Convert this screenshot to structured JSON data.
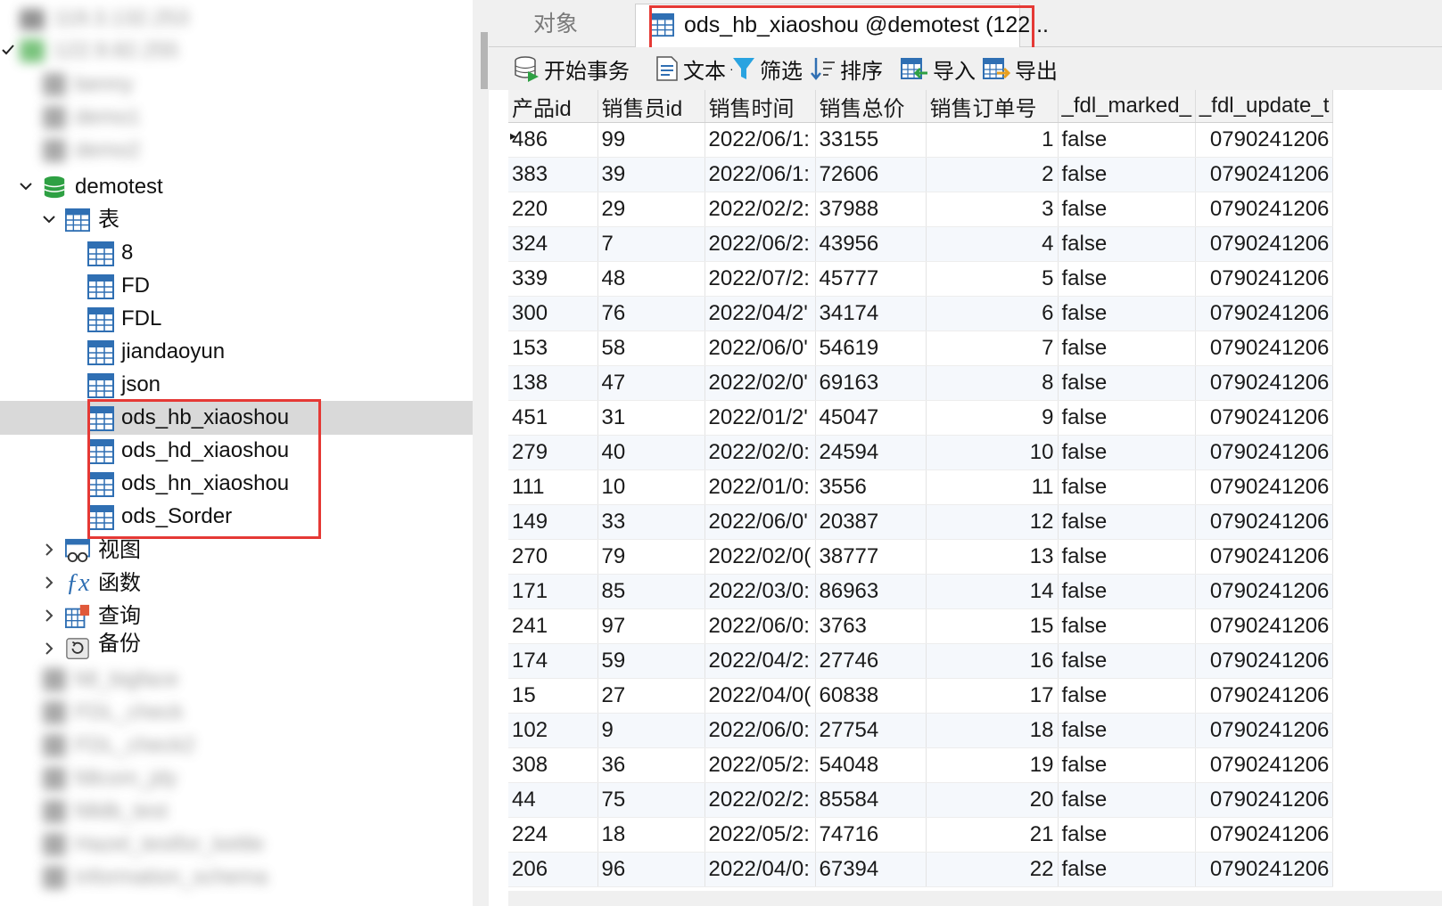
{
  "nav": {
    "connections": [
      "119.3.132.253",
      "122.9.82.255"
    ],
    "dbs_before": [
      "benny",
      "demo1",
      "demo2"
    ],
    "database": "demotest",
    "tables_group": "表",
    "tables": [
      "8",
      "FD",
      "FDL",
      "jiandaoyun",
      "json",
      "ods_hb_xiaoshou",
      "ods_hd_xiaoshou",
      "ods_hn_xiaoshou",
      "ods_Sorder"
    ],
    "selected_table": "ods_hb_xiaoshou",
    "groups": [
      "视图",
      "函数",
      "查询",
      "备份"
    ],
    "dbs_after": [
      "fdl_bigface",
      "FDL_check",
      "FDL_check2",
      "fdlcom_jdy",
      "fdldb_test",
      "Hazel_testfor_kettle",
      "information_schema"
    ]
  },
  "tabs": {
    "objects": "对象",
    "active": "ods_hb_xiaoshou @demotest (122..."
  },
  "toolbar": {
    "begin_tx": "开始事务",
    "text": "文本",
    "filter": "筛选",
    "sort": "排序",
    "import": "导入",
    "export": "导出"
  },
  "grid": {
    "columns": [
      "产品id",
      "销售员id",
      "销售时间",
      "销售总价",
      "销售订单号",
      "_fdl_marked_",
      "_fdl_update_t"
    ],
    "rows": [
      [
        "486",
        "99",
        "2022/06/1:",
        "33155",
        "1",
        "false",
        "0790241206"
      ],
      [
        "383",
        "39",
        "2022/06/1:",
        "72606",
        "2",
        "false",
        "0790241206"
      ],
      [
        "220",
        "29",
        "2022/02/2:",
        "37988",
        "3",
        "false",
        "0790241206"
      ],
      [
        "324",
        "7",
        "2022/06/2:",
        "43956",
        "4",
        "false",
        "0790241206"
      ],
      [
        "339",
        "48",
        "2022/07/2:",
        "45777",
        "5",
        "false",
        "0790241206"
      ],
      [
        "300",
        "76",
        "2022/04/2'",
        "34174",
        "6",
        "false",
        "0790241206"
      ],
      [
        "153",
        "58",
        "2022/06/0'",
        "54619",
        "7",
        "false",
        "0790241206"
      ],
      [
        "138",
        "47",
        "2022/02/0'",
        "69163",
        "8",
        "false",
        "0790241206"
      ],
      [
        "451",
        "31",
        "2022/01/2'",
        "45047",
        "9",
        "false",
        "0790241206"
      ],
      [
        "279",
        "40",
        "2022/02/0:",
        "24594",
        "10",
        "false",
        "0790241206"
      ],
      [
        "111",
        "10",
        "2022/01/0:",
        "3556",
        "11",
        "false",
        "0790241206"
      ],
      [
        "149",
        "33",
        "2022/06/0'",
        "20387",
        "12",
        "false",
        "0790241206"
      ],
      [
        "270",
        "79",
        "2022/02/0(",
        "38777",
        "13",
        "false",
        "0790241206"
      ],
      [
        "171",
        "85",
        "2022/03/0:",
        "86963",
        "14",
        "false",
        "0790241206"
      ],
      [
        "241",
        "97",
        "2022/06/0:",
        "3763",
        "15",
        "false",
        "0790241206"
      ],
      [
        "174",
        "59",
        "2022/04/2:",
        "27746",
        "16",
        "false",
        "0790241206"
      ],
      [
        "15",
        "27",
        "2022/04/0(",
        "60838",
        "17",
        "false",
        "0790241206"
      ],
      [
        "102",
        "9",
        "2022/06/0:",
        "27754",
        "18",
        "false",
        "0790241206"
      ],
      [
        "308",
        "36",
        "2022/05/2:",
        "54048",
        "19",
        "false",
        "0790241206"
      ],
      [
        "44",
        "75",
        "2022/02/2:",
        "85584",
        "20",
        "false",
        "0790241206"
      ],
      [
        "224",
        "18",
        "2022/05/2:",
        "74716",
        "21",
        "false",
        "0790241206"
      ],
      [
        "206",
        "96",
        "2022/04/0:",
        "67394",
        "22",
        "false",
        "0790241206"
      ]
    ]
  },
  "colors": {
    "highlight": "#e53935",
    "table_icon": "#2f6fb3",
    "db_icon": "#2ea043",
    "selected_row": "#d9d9d9"
  }
}
